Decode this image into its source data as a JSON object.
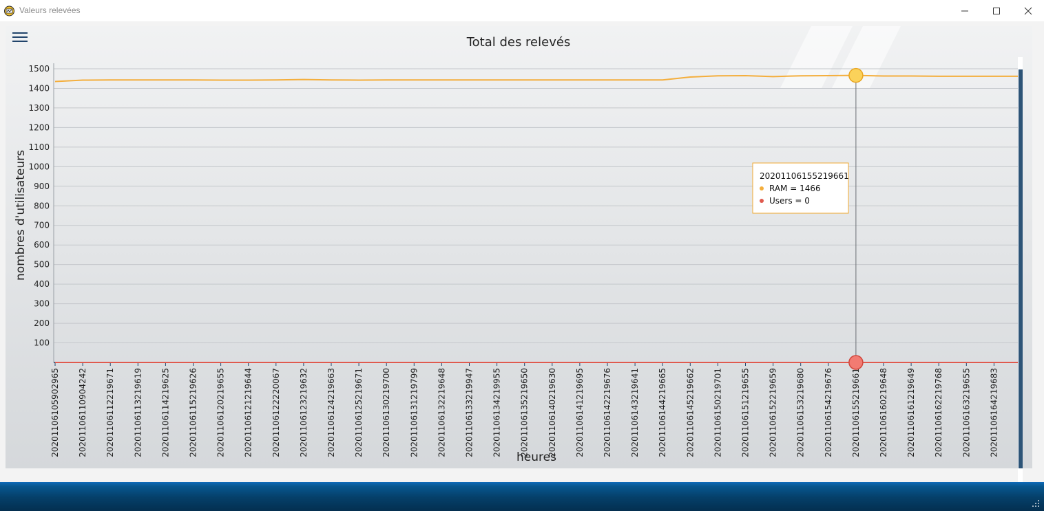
{
  "window": {
    "title": "Valeurs relevées",
    "icon": "app-logo-icon",
    "controls": [
      "minimize-icon",
      "maximize-icon",
      "close-icon"
    ]
  },
  "toolbar": {
    "menu_icon": "hamburger-menu-icon"
  },
  "colors": {
    "ram": "#f4ae3c",
    "users": "#e05a4e",
    "tooltip_border": "#f0a830",
    "scroll_thumb": "#2d5477",
    "taskbar": "#05406a"
  },
  "tooltip": {
    "title": "20201106155219661",
    "lines": [
      "RAM = 1466",
      "Users = 0"
    ]
  },
  "chart_data": {
    "type": "line",
    "title": "Total des relevés",
    "xlabel": "heures",
    "ylabel": "nombres d'utilisateurs",
    "ylim": [
      0,
      1500
    ],
    "yticks": [
      100,
      200,
      300,
      400,
      500,
      600,
      700,
      800,
      900,
      1000,
      1100,
      1200,
      1300,
      1400,
      1500
    ],
    "grid": true,
    "categories": [
      "20201106105902965",
      "20201106110904242",
      "20201106112219671",
      "20201106113219619",
      "20201106114219625",
      "20201106115219626",
      "20201106120219655",
      "20201106121219644",
      "20201106122220067",
      "20201106123219632",
      "20201106124219663",
      "20201106125219671",
      "20201106130219700",
      "20201106131219799",
      "20201106132219648",
      "20201106133219947",
      "20201106134219955",
      "20201106135219650",
      "20201106140219630",
      "20201106141219695",
      "20201106142219676",
      "20201106143219641",
      "20201106144219665",
      "20201106145219662",
      "20201106150219701",
      "20201106151219655",
      "20201106152219659",
      "20201106153219680",
      "20201106154219676",
      "20201106155219661",
      "20201106160219648",
      "20201106161219649",
      "20201106162219768",
      "20201106163219655",
      "20201106164219683"
    ],
    "series": [
      {
        "name": "RAM",
        "values": [
          1435,
          1442,
          1443,
          1443,
          1443,
          1443,
          1442,
          1442,
          1443,
          1445,
          1443,
          1442,
          1443,
          1443,
          1443,
          1443,
          1443,
          1443,
          1443,
          1443,
          1443,
          1443,
          1443,
          1458,
          1464,
          1465,
          1460,
          1464,
          1465,
          1466,
          1463,
          1463,
          1462,
          1462,
          1462
        ]
      },
      {
        "name": "Users",
        "values": [
          0,
          0,
          0,
          0,
          0,
          0,
          0,
          0,
          0,
          0,
          0,
          0,
          0,
          0,
          0,
          0,
          0,
          0,
          0,
          0,
          0,
          0,
          0,
          0,
          0,
          0,
          0,
          0,
          0,
          0,
          0,
          0,
          0,
          0,
          0
        ]
      }
    ],
    "highlight_index": 29
  }
}
